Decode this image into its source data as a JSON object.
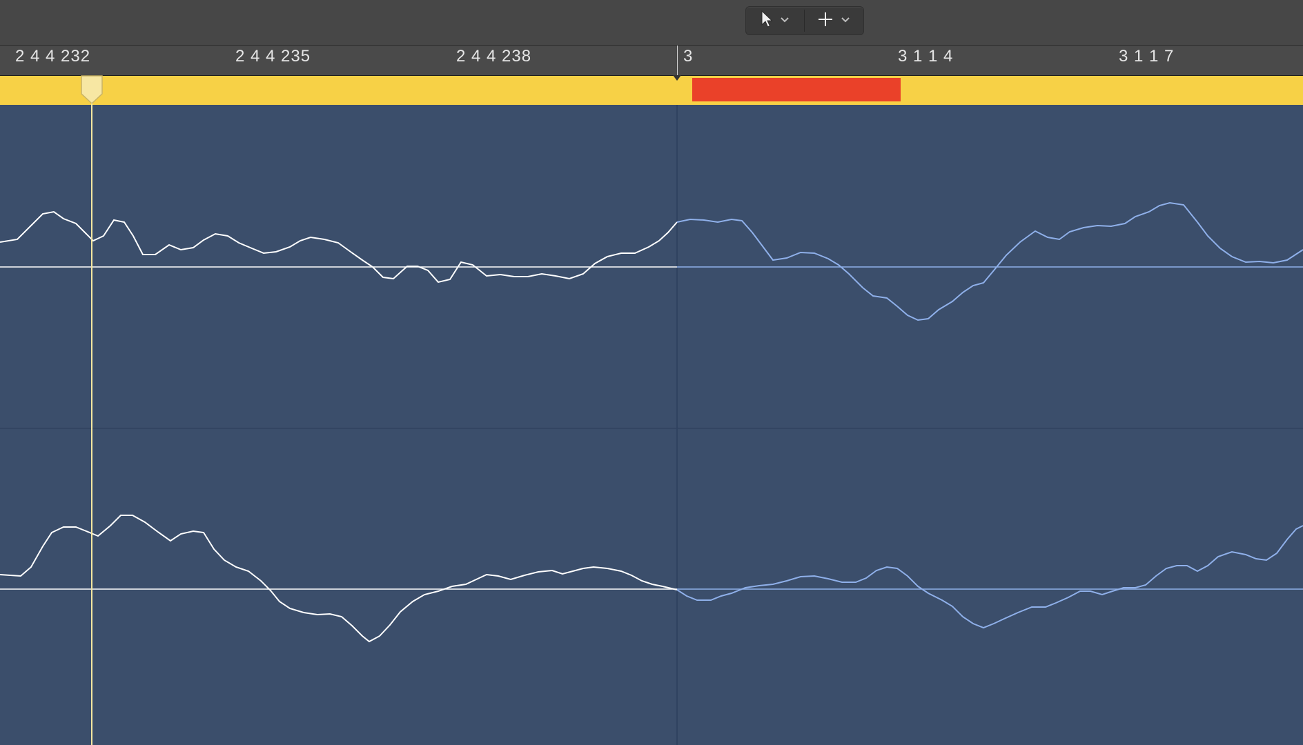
{
  "toolbar": {
    "pointer_tool": "pointer-tool",
    "pencil_tool": "crosshair-tool"
  },
  "ruler": {
    "labels": [
      "2 4 4 232",
      "2 4 4 235",
      "2 4 4 238",
      "3",
      "3 1 1 4",
      "3 1 1 7"
    ]
  },
  "colors": {
    "background": "#3b4e6b",
    "region_yellow": "#f7d146",
    "selection_red": "#ea4129",
    "waveform_white": "#ffffff",
    "waveform_blue": "#8fb0ea",
    "playhead": "#f5e7a0"
  }
}
